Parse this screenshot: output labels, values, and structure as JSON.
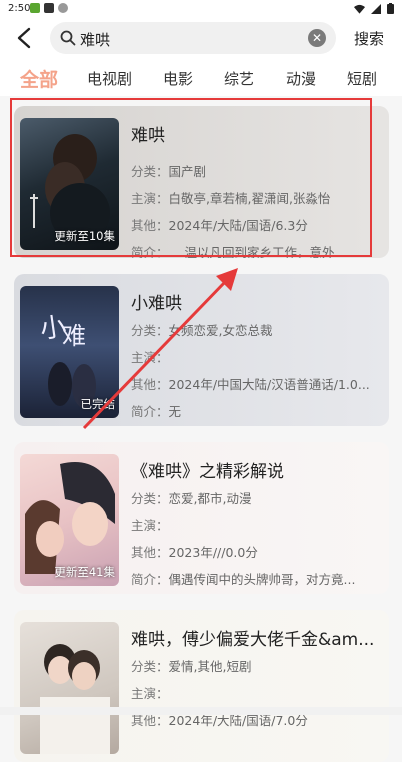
{
  "status_bar": {
    "time": "2:50"
  },
  "search": {
    "query": "难哄",
    "submit_label": "搜索"
  },
  "tabs": [
    {
      "label": "全部",
      "active": true
    },
    {
      "label": "电视剧",
      "active": false
    },
    {
      "label": "电影",
      "active": false
    },
    {
      "label": "综艺",
      "active": false
    },
    {
      "label": "动漫",
      "active": false
    },
    {
      "label": "短剧",
      "active": false
    }
  ],
  "results": [
    {
      "title": "难哄",
      "badge": "更新至10集",
      "rows": [
        {
          "key": "分类：",
          "value": "国产剧"
        },
        {
          "key": "主演：",
          "value": "白敬亭,章若楠,翟潇闻,张淼怡"
        },
        {
          "key": "其他：",
          "value": "2024年/大陆/国语/6.3分"
        },
        {
          "key": "简介：",
          "value": "温以凡回到家乡工作，意外..."
        }
      ]
    },
    {
      "title": "小难哄",
      "badge": "已完结",
      "rows": [
        {
          "key": "分类：",
          "value": "女频恋爱,女恋总裁"
        },
        {
          "key": "主演：",
          "value": ""
        },
        {
          "key": "其他：",
          "value": "2024年/中国大陆/汉语普通话/1.0..."
        },
        {
          "key": "简介：",
          "value": "无"
        }
      ]
    },
    {
      "title": "《难哄》之精彩解说",
      "badge": "更新至41集",
      "rows": [
        {
          "key": "分类：",
          "value": "恋爱,都市,动漫"
        },
        {
          "key": "主演：",
          "value": ""
        },
        {
          "key": "其他：",
          "value": "2023年///0.0分"
        },
        {
          "key": "简介：",
          "value": "偶遇传闻中的头牌帅哥，对方竟..."
        }
      ]
    },
    {
      "title": "难哄，傅少偏爱大佬千金&am...",
      "badge": "",
      "rows": [
        {
          "key": "分类：",
          "value": "爱情,其他,短剧"
        },
        {
          "key": "主演：",
          "value": ""
        },
        {
          "key": "其他：",
          "value": "2024年/大陆/国语/7.0分"
        }
      ]
    }
  ],
  "colors": {
    "accent_tab": "#f4a38a",
    "annotation_red": "#e53a3a"
  }
}
